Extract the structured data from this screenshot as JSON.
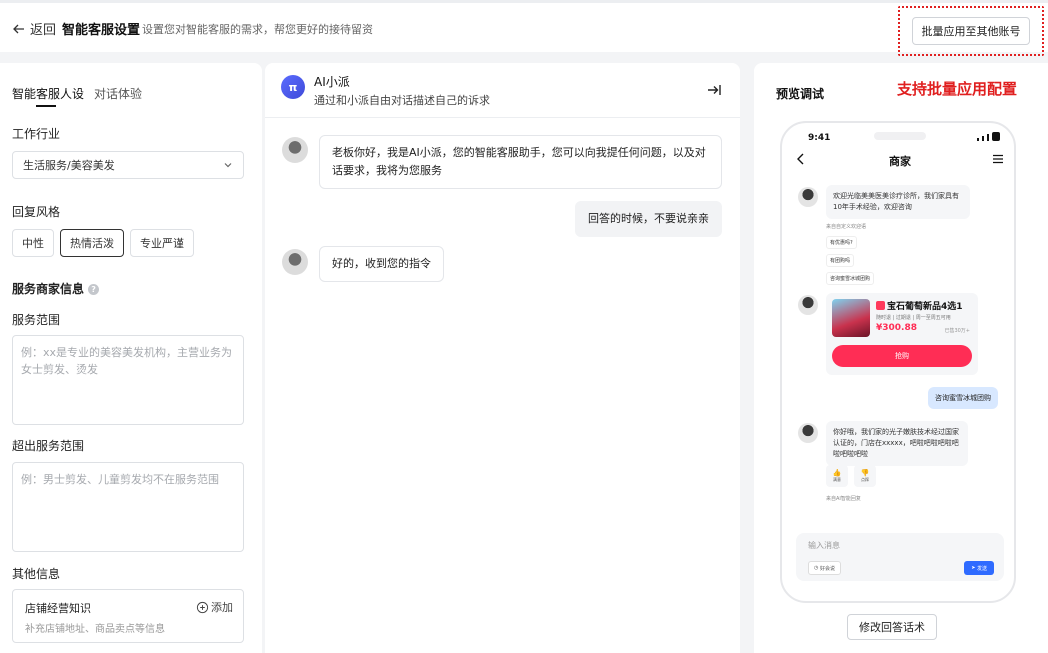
{
  "header": {
    "back_label": "返回",
    "title": "智能客服设置",
    "description": "设置您对智能客服的需求，帮您更好的接待留资",
    "batch_button": "批量应用至其他账号"
  },
  "left": {
    "tabs": [
      {
        "label": "智能客服人设",
        "active": true
      },
      {
        "label": "对话体验",
        "active": false
      }
    ],
    "industry_label": "工作行业",
    "industry_value": "生活服务/美容美发",
    "style_label": "回复风格",
    "styles": [
      {
        "label": "中性",
        "selected": false
      },
      {
        "label": "热情活泼",
        "selected": true
      },
      {
        "label": "专业严谨",
        "selected": false
      }
    ],
    "merchant_info_label": "服务商家信息",
    "scope_label": "服务范围",
    "scope_placeholder": "例：xx是专业的美容美发机构，主营业务为女士剪发、烫发",
    "out_scope_label": "超出服务范围",
    "out_scope_placeholder": "例：男士剪发、儿童剪发均不在服务范围",
    "other_label": "其他信息",
    "kb_title": "店铺经营知识",
    "kb_add": "添加",
    "kb_sub": "补充店铺地址、商品卖点等信息"
  },
  "chat": {
    "ai_avatar_text": "π",
    "ai_name": "AI小派",
    "ai_desc": "通过和小派自由对话描述自己的诉求",
    "messages": [
      {
        "from": "ai",
        "text": "老板你好，我是AI小派，您的智能客服助手，您可以向我提任何问题，以及对话要求，我将为您服务"
      },
      {
        "from": "user",
        "text": "回答的时候，不要说亲亲"
      },
      {
        "from": "ai",
        "text": "好的，收到您的指令"
      }
    ]
  },
  "preview": {
    "title": "预览调试",
    "batch_note": "支持批量应用配置",
    "phone": {
      "time": "9:41",
      "nav_title": "商家",
      "welcome": "欢迎光临美美医美诊疗诊所，我们家具有10年手术经验，欢迎咨询",
      "welcome_tag": "来自自定义欢迎语",
      "chips": [
        "有优惠吗?",
        "有团购吗",
        "咨询蜜雪冰城团购"
      ],
      "product": {
        "name": "宝石葡萄新品4选1",
        "sub": "随时退 | 过期退 | 周一至周五可用",
        "price": "¥300.88",
        "meta": "已售30万+",
        "buy": "抢购"
      },
      "user_msg": "咨询蜜雪冰城团购",
      "reply": "你好哦，我们家的光子嫩肤技术经过国家认证的，门店在xxxxx，吧啦吧啦吧啦吧啦吧啦吧啦",
      "like": "满意",
      "dislike": "点踩",
      "reply_tag": "来自AI智能回复",
      "input_placeholder": "输入消息",
      "good_label": "好会说",
      "send_label": "发送"
    },
    "edit_button": "修改回答话术"
  }
}
